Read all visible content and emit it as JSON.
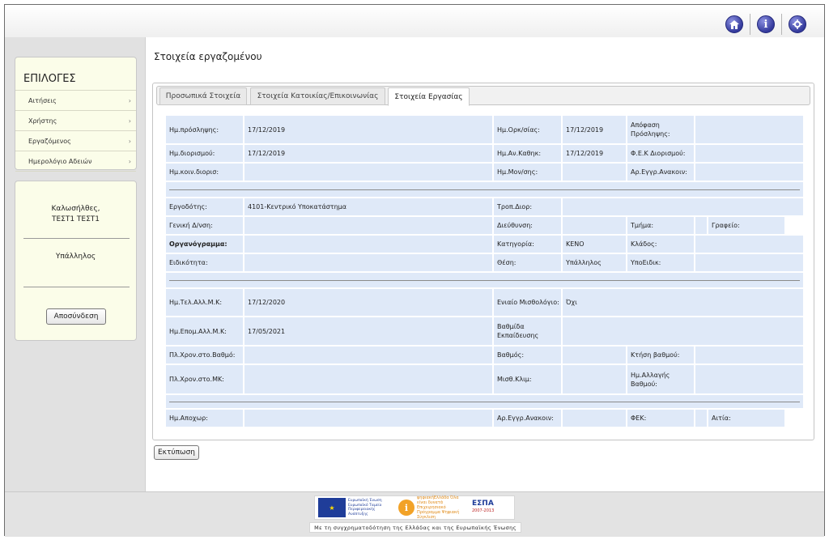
{
  "topbar": {
    "icons": [
      "home-icon",
      "info-icon",
      "settings-icon"
    ]
  },
  "sidebar": {
    "menu_title": "ΕΠΙΛΟΓΕΣ",
    "items": [
      {
        "label": "Αιτήσεις"
      },
      {
        "label": "Χρήστης"
      },
      {
        "label": "Εργαζόμενος"
      },
      {
        "label": "Ημερολόγιο Αδειών"
      }
    ],
    "user": {
      "greeting": "Καλωσήλθες,",
      "name": "ΤΕΣΤ1 ΤΕΣΤ1",
      "role": "Υπάλληλος",
      "logout_label": "Αποσύνδεση"
    }
  },
  "main": {
    "title": "Στοιχεία εργαζομένου",
    "tabs": [
      {
        "label": "Προσωπικά Στοιχεία"
      },
      {
        "label": "Στοιχεία Κατοικίας/Επικοινωνίας"
      },
      {
        "label": "Στοιχεία Εργασίας"
      }
    ],
    "active_tab": "Στοιχεία Εργασίας",
    "fields": {
      "hire_date_label": "Ημ.πρόσληψης:",
      "hire_date": "17/12/2019",
      "oath_date_label": "Ημ.Ορκ/σίας:",
      "oath_date": "17/12/2019",
      "hire_decision_label": "Απόφαση Πρόσληψης:",
      "appoint_date_label": "Ημ.διορισμού:",
      "appoint_date": "17/12/2019",
      "duty_date_label": "Ημ.Αν.Καθηκ:",
      "duty_date": "17/12/2019",
      "fek_appoint_label": "Φ.Ε.Κ Διορισμού:",
      "common_appoint_label": "Ημ.κοιν.διορισ:",
      "tenure_date_label": "Ημ.Μον/σης:",
      "reg_announce_label": "Αρ.Εγγρ.Ανακοιν:",
      "employer_label": "Εργοδότης:",
      "employer": "4101-Κεντρικό Υποκατάστημα",
      "appoint_mode_label": "Τροπ.Διορ:",
      "general_dir_label": "Γενική Δ/νση:",
      "direction_label": "Διεύθυνση:",
      "department_label": "Τμήμα:",
      "office_label": "Γραφείο:",
      "org_chart_label": "Οργανόγραμμα:",
      "category_label": "Κατηγορία:",
      "category": "ΚΕΝΟ",
      "branch_label": "Κλάδος:",
      "specialty_label": "Ειδικότητα:",
      "position_label": "Θέση:",
      "position": "Υπάλληλος",
      "sub_specialty_label": "ΥποΕιδικ:",
      "last_mk_change_label": "Ημ.Τελ.Αλλ.Μ.Κ:",
      "last_mk_change": "17/12/2020",
      "unified_payroll_label": "Ενιαίο Μισθολόγιο:",
      "unified_payroll": "Όχι",
      "next_mk_change_label": "Ημ.Επομ.Αλλ.Μ.Κ:",
      "next_mk_change": "17/05/2021",
      "edu_level_label": "Βαθμίδα Εκπαίδευσης",
      "time_in_grade_label": "Πλ.Χρον.στο.Βαθμό:",
      "grade_label": "Βαθμός:",
      "grade_acq_label": "Κτήση βαθμού:",
      "time_in_mk_label": "Πλ.Χρον.στο.ΜΚ:",
      "pay_scale_label": "Μισθ.Κλιμ:",
      "grade_change_label": "Ημ.Αλλαγής Βαθμού:",
      "departure_label": "Ημ.Αποχωρ:",
      "reg_announce2_label": "Αρ.Εγγρ.Ανακοιν:",
      "fek_label": "ΦΕΚ:",
      "reason_label": "Αιτία:"
    },
    "print_label": "Εκτύπωση"
  },
  "footer": {
    "eu_text": "Ευρωπαϊκή Ένωση Ευρωπαϊκό Ταμείο Περιφερειακής Ανάπτυξης",
    "digital_text": "ψηφιακήΕλλάδα Όλα είναι δυνατά Επιχειρησιακό Πρόγραμμα Ψηφιακή Σύγκλιση",
    "espa_text": "ΕΣΠΑ",
    "espa_years": "2007-2013",
    "note": "Με τη συγχρηματοδότηση της Ελλάδας και της Ευρωπαϊκής Ένωσης"
  }
}
